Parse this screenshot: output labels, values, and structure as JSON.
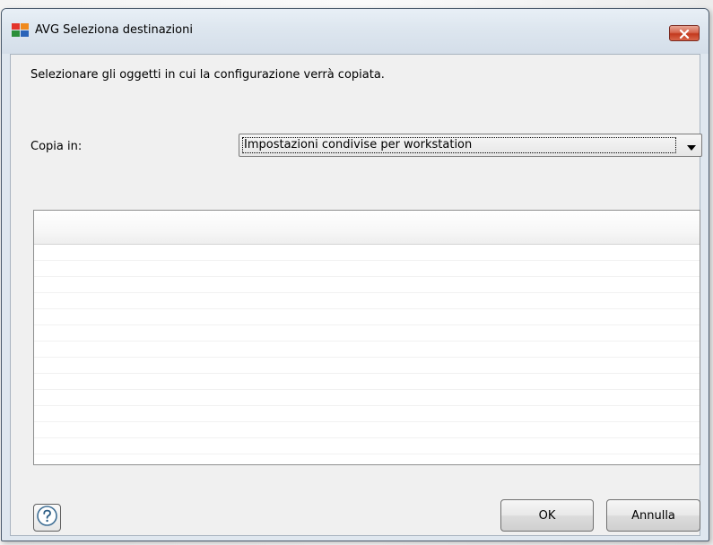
{
  "window": {
    "title": "AVG Seleziona destinazioni",
    "icons": {
      "app": "avg-logo-icon",
      "close": "close-icon"
    }
  },
  "dialog": {
    "instruction": "Selezionare gli oggetti in cui la configurazione verrà copiata.",
    "copy_in_label": "Copia in:",
    "copy_in_select": {
      "value": "Impostazioni condivise per workstation",
      "icon": "chevron-down-icon"
    },
    "targets_list": {
      "columns": [],
      "rows": []
    }
  },
  "footer": {
    "help_icon": "help-icon",
    "ok_label": "OK",
    "cancel_label": "Annulla"
  },
  "colors": {
    "title_bar": "#dde6ef",
    "close_button": "#c3391e",
    "dialog_background": "#f0f0f0"
  }
}
